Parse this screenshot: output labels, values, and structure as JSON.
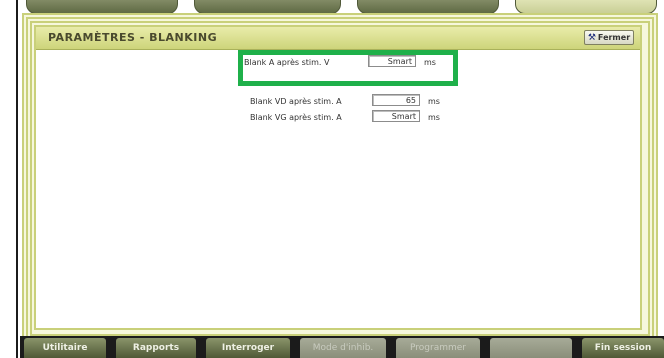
{
  "top_tabs": [
    "",
    "",
    "",
    ""
  ],
  "panel": {
    "title": "PARAMÈTRES - BLANKING",
    "close_label": "Fermer"
  },
  "rows": [
    {
      "label": "Blank A après stim. V",
      "value": "Smart",
      "unit": "ms"
    },
    {
      "label": "Blank VD après stim. A",
      "value": "65",
      "unit": "ms"
    },
    {
      "label": "Blank VG après stim. A",
      "value": "Smart",
      "unit": "ms"
    }
  ],
  "bottom_bar": {
    "buttons": [
      {
        "label": "Utilitaire",
        "enabled": true
      },
      {
        "label": "Rapports",
        "enabled": true
      },
      {
        "label": "Interroger",
        "enabled": true
      },
      {
        "label": "Mode d'inhib.",
        "enabled": false
      },
      {
        "label": "Programmer",
        "enabled": false
      },
      {
        "label": "",
        "enabled": false
      },
      {
        "label": "Fin session",
        "enabled": true
      }
    ]
  },
  "colors": {
    "highlight": "#1fb04a",
    "title_bar": "#cdd47a",
    "toolbar_button": "#5f6a44"
  }
}
